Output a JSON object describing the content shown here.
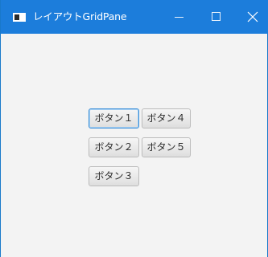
{
  "window": {
    "title": "レイアウトGridPane",
    "title_bar_color": "#1c7ddb",
    "background_color": "#f3f3f3",
    "controls": {
      "minimize_icon": "minimize-icon",
      "maximize_icon": "maximize-icon",
      "close_icon": "close-icon"
    }
  },
  "grid": {
    "buttons": [
      {
        "label": "ボタン１",
        "column": 0,
        "row": 0,
        "focused": true
      },
      {
        "label": "ボタン２",
        "column": 0,
        "row": 1,
        "focused": false
      },
      {
        "label": "ボタン３",
        "column": 0,
        "row": 2,
        "focused": false
      },
      {
        "label": "ボタン４",
        "column": 1,
        "row": 0,
        "focused": false
      },
      {
        "label": "ボタン５",
        "column": 1,
        "row": 1,
        "focused": false
      }
    ],
    "focus_color": "#3a8fd8"
  }
}
